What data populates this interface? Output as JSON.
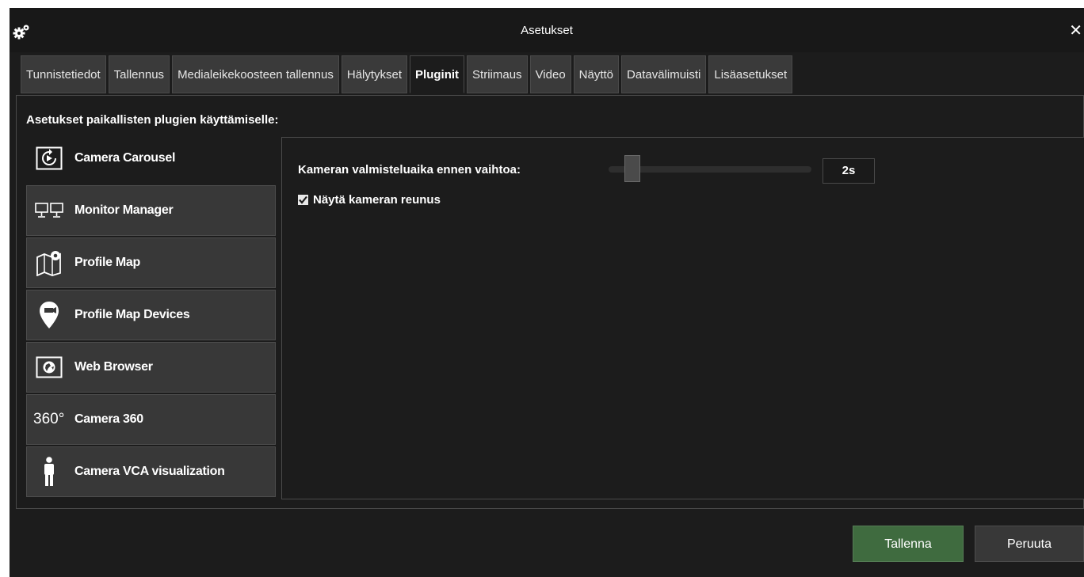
{
  "window": {
    "title": "Asetukset",
    "close_icon": "close-icon",
    "settings_icon": "gear-icon"
  },
  "tabs": [
    {
      "label": "Tunnistetiedot",
      "active": false
    },
    {
      "label": "Tallennus",
      "active": false
    },
    {
      "label": "Medialeikekoosteen tallennus",
      "active": false
    },
    {
      "label": "Hälytykset",
      "active": false
    },
    {
      "label": "Pluginit",
      "active": true
    },
    {
      "label": "Striimaus",
      "active": false
    },
    {
      "label": "Video",
      "active": false
    },
    {
      "label": "Näyttö",
      "active": false
    },
    {
      "label": "Datavälimuisti",
      "active": false
    },
    {
      "label": "Lisäasetukset",
      "active": false
    }
  ],
  "section_title": "Asetukset paikallisten plugien käyttämiselle:",
  "plugins": [
    {
      "label": "Camera Carousel",
      "icon": "carousel-icon",
      "active": true
    },
    {
      "label": "Monitor Manager",
      "icon": "monitors-icon",
      "active": false
    },
    {
      "label": "Profile Map",
      "icon": "map-icon",
      "active": false
    },
    {
      "label": "Profile Map Devices",
      "icon": "map-pin-icon",
      "active": false
    },
    {
      "label": "Web Browser",
      "icon": "globe-icon",
      "active": false
    },
    {
      "label": "Camera 360",
      "icon": "camera-360-icon",
      "icon_text": "360°",
      "active": false
    },
    {
      "label": "Camera VCA visualization",
      "icon": "person-icon",
      "active": false
    }
  ],
  "carousel_settings": {
    "slider_label": "Kameran valmisteluaika ennen vaihtoa:",
    "slider_value": "2s",
    "checkbox_label": "Näytä kameran reunus",
    "checkbox_checked": true
  },
  "footer": {
    "save_label": "Tallenna",
    "cancel_label": "Peruuta"
  },
  "colors": {
    "background": "#1c1c1c",
    "tab_bg": "#3a3a3a",
    "save_button": "#3f6b3f"
  }
}
